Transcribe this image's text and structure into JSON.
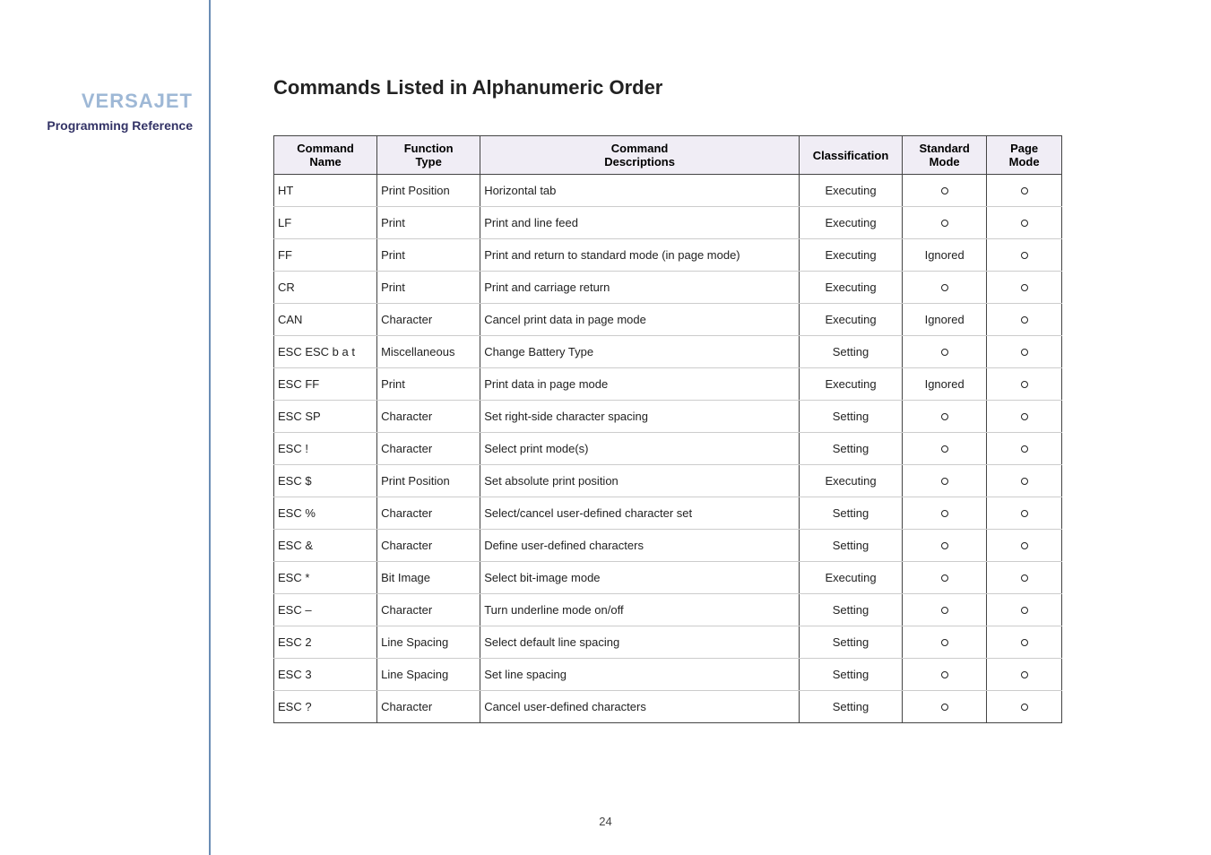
{
  "sidebar": {
    "brand": "VERSAJET",
    "subtitle": "Programming Reference"
  },
  "title": "Commands Listed in Alphanumeric Order",
  "headers": {
    "name_l1": "Command",
    "name_l2": "Name",
    "ftype_l1": "Function",
    "ftype_l2": "Type",
    "desc_l1": "Command",
    "desc_l2": "Descriptions",
    "class": "Classification",
    "std_l1": "Standard",
    "std_l2": "Mode",
    "page_l1": "Page",
    "page_l2": "Mode"
  },
  "rows": [
    {
      "name": "HT",
      "ftype": "Print Position",
      "desc": "Horizontal tab",
      "cls": "Executing",
      "std": "circle",
      "page": "circle"
    },
    {
      "name": "LF",
      "ftype": "Print",
      "desc": "Print and line feed",
      "cls": "Executing",
      "std": "circle",
      "page": "circle"
    },
    {
      "name": "FF",
      "ftype": "Print",
      "desc": "Print and return to standard mode (in page mode)",
      "cls": "Executing",
      "std": "Ignored",
      "page": "circle"
    },
    {
      "name": "CR",
      "ftype": "Print",
      "desc": "Print and carriage return",
      "cls": "Executing",
      "std": "circle",
      "page": "circle"
    },
    {
      "name": "CAN",
      "ftype": "Character",
      "desc": "Cancel print data in page mode",
      "cls": "Executing",
      "std": "Ignored",
      "page": "circle"
    },
    {
      "name": "ESC ESC b a t",
      "ftype": "Miscellaneous",
      "desc": "Change Battery Type",
      "cls": "Setting",
      "std": "circle",
      "page": "circle"
    },
    {
      "name": "ESC FF",
      "ftype": "Print",
      "desc": "Print data in page mode",
      "cls": "Executing",
      "std": "Ignored",
      "page": "circle"
    },
    {
      "name": "ESC SP",
      "ftype": "Character",
      "desc": "Set right-side character spacing",
      "cls": "Setting",
      "std": "circle",
      "page": "circle"
    },
    {
      "name": "ESC !",
      "ftype": "Character",
      "desc": "Select print mode(s)",
      "cls": "Setting",
      "std": "circle",
      "page": "circle"
    },
    {
      "name": "ESC $",
      "ftype": "Print Position",
      "desc": "Set absolute print position",
      "cls": "Executing",
      "std": "circle",
      "page": "circle"
    },
    {
      "name": "ESC %",
      "ftype": "Character",
      "desc": "Select/cancel user-defined character set",
      "cls": "Setting",
      "std": "circle",
      "page": "circle"
    },
    {
      "name": "ESC &",
      "ftype": "Character",
      "desc": "Define user-defined characters",
      "cls": "Setting",
      "std": "circle",
      "page": "circle"
    },
    {
      "name": "ESC *",
      "ftype": "Bit Image",
      "desc": "Select bit-image mode",
      "cls": "Executing",
      "std": "circle",
      "page": "circle"
    },
    {
      "name": "ESC –",
      "ftype": "Character",
      "desc": "Turn underline mode on/off",
      "cls": "Setting",
      "std": "circle",
      "page": "circle"
    },
    {
      "name": "ESC 2",
      "ftype": "Line Spacing",
      "desc": "Select default line spacing",
      "cls": "Setting",
      "std": "circle",
      "page": "circle"
    },
    {
      "name": "ESC 3",
      "ftype": "Line Spacing",
      "desc": "Set line spacing",
      "cls": "Setting",
      "std": "circle",
      "page": "circle"
    },
    {
      "name": "ESC ?",
      "ftype": "Character",
      "desc": "Cancel user-defined characters",
      "cls": "Setting",
      "std": "circle",
      "page": "circle"
    }
  ],
  "page_number": "24"
}
